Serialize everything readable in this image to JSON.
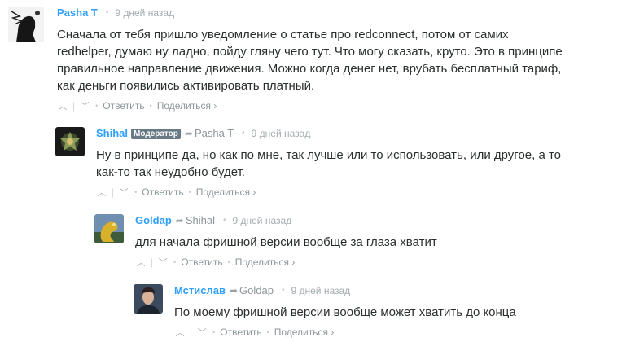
{
  "comments": [
    {
      "author": "Pasha T",
      "badge": "",
      "reply_to": "",
      "time": "9 дней назад",
      "lines": [
        "Сначала от тебя пришло уведомление о статье про redconnect, потом от самих",
        "redhelper, думаю ну ладно, пойду гляну чего тут. Что могу сказать, круто. Это в принципе",
        "правильное направление движения. Можно когда денег нет, врубать бесплатный тариф,",
        "как деньги появились активировать платный."
      ],
      "reply_label": "Ответить",
      "share_label": "Поделиться ›"
    },
    {
      "author": "Shihal",
      "badge": "Модератор",
      "reply_to": "Pasha T",
      "time": "9 дней назад",
      "lines": [
        "Ну в принципе да, но как по мне, так лучше или то использовать, или другое, а то",
        "как-то так неудобно будет."
      ],
      "reply_label": "Ответить",
      "share_label": "Поделиться ›"
    },
    {
      "author": "Goldap",
      "badge": "",
      "reply_to": "Shihal",
      "time": "9 дней назад",
      "lines": [
        "для начала фришной версии вообще за глаза хватит"
      ],
      "reply_label": "Ответить",
      "share_label": "Поделиться ›"
    },
    {
      "author": "Мстислав",
      "badge": "",
      "reply_to": "Goldap",
      "time": "9 дней назад",
      "lines": [
        "По моему фришной версии вообще может хватить до конца"
      ],
      "reply_label": "Ответить",
      "share_label": "Поделиться ›"
    }
  ],
  "icons": {
    "upvote": "chevron-up-icon",
    "downvote": "chevron-down-icon",
    "reply_arrow": "reply-arrow-icon"
  },
  "colors": {
    "author": "#2e9fff",
    "badge_bg": "#687a86",
    "meta": "#a4acb0",
    "text": "#2a2e2e"
  }
}
